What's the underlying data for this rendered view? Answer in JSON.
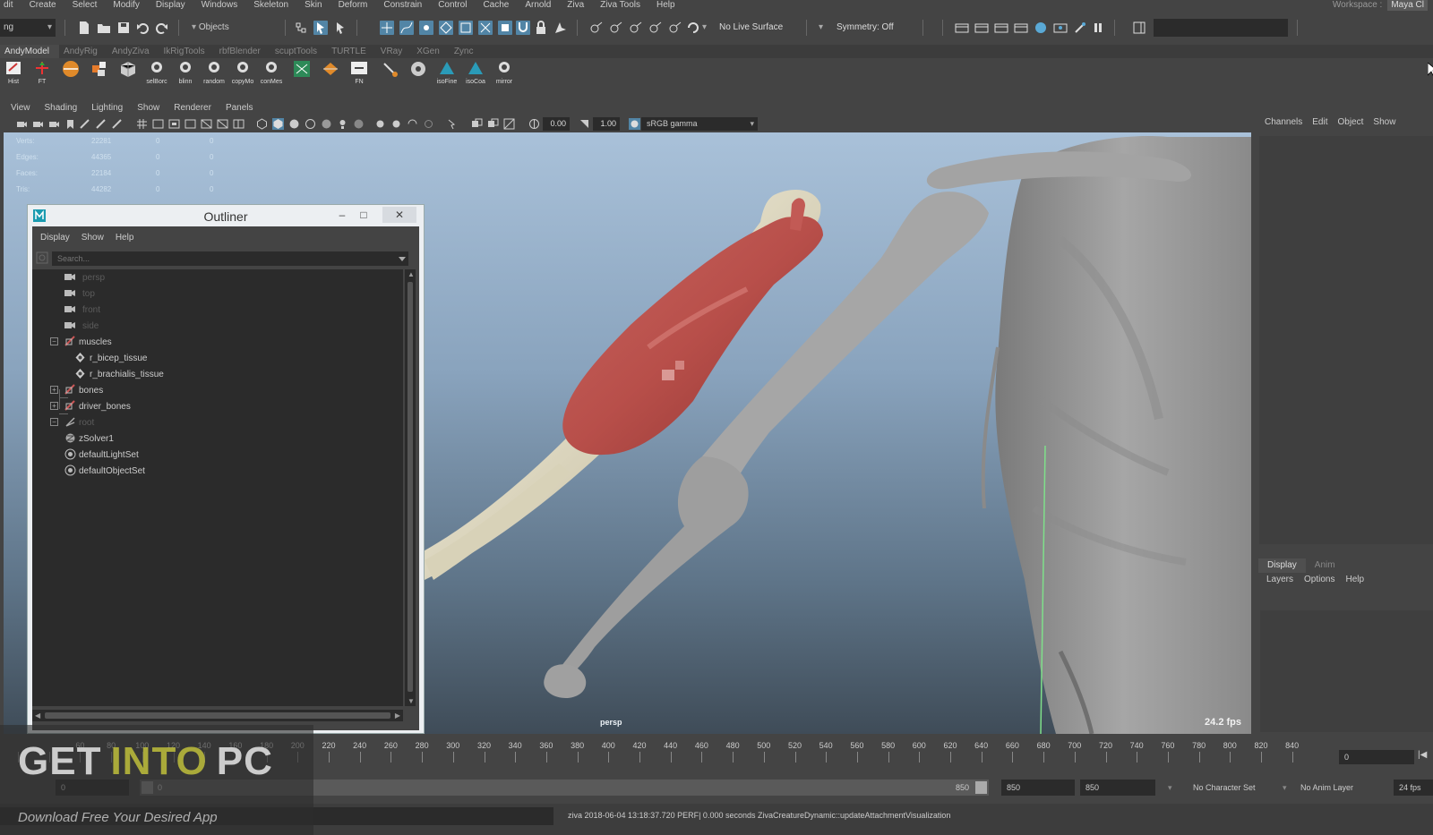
{
  "menubar": {
    "items": [
      "dit",
      "Create",
      "Select",
      "Modify",
      "Display",
      "Windows",
      "Skeleton",
      "Skin",
      "Deform",
      "Constrain",
      "Control",
      "Cache",
      "Arnold",
      "Ziva",
      "Ziva Tools",
      "Help"
    ],
    "workspace_label": "Workspace :",
    "workspace_value": "Maya Cl"
  },
  "statusline": {
    "menuset": "ng",
    "selection_mode": "Objects",
    "live_surface": "No Live Surface",
    "symmetry": "Symmetry: Off"
  },
  "shelf": {
    "tabs": [
      "AndyModel",
      "AndyRig",
      "AndyZiva",
      "IkRigTools",
      "rbfBlender",
      "scuptTools",
      "TURTLE",
      "VRay",
      "XGen",
      "Zync"
    ],
    "active_tab": "AndyModel",
    "buttons": [
      "Hist",
      "FT",
      "",
      "",
      "",
      "selBorc",
      "blinn",
      "random",
      "copyMo",
      "conMes",
      "",
      "",
      "FN",
      "",
      "",
      "isoFine",
      "isoCoa",
      "mirror"
    ]
  },
  "viewport": {
    "menu": [
      "View",
      "Shading",
      "Lighting",
      "Show",
      "Renderer",
      "Panels"
    ],
    "exposure": "0.00",
    "gamma": "1.00",
    "color_space": "sRGB gamma",
    "camera": "persp",
    "fps": "24.2 fps",
    "hud": [
      {
        "label": "Verts:",
        "value": "22281",
        "a": "0",
        "b": "0"
      },
      {
        "label": "Edges:",
        "value": "44365",
        "a": "0",
        "b": "0"
      },
      {
        "label": "Faces:",
        "value": "22184",
        "a": "0",
        "b": "0"
      },
      {
        "label": "Tris:",
        "value": "44282",
        "a": "0",
        "b": "0"
      }
    ],
    "colors": {
      "muscle": "#b8504c",
      "bone_ivory": "#e2dcc4",
      "bone_gray": "#a5a5a5"
    }
  },
  "outliner": {
    "title": "Outliner",
    "menu": [
      "Display",
      "Show",
      "Help"
    ],
    "search_placeholder": "Search...",
    "items": [
      {
        "label": "persp",
        "icon": "camera-icon",
        "dim": true
      },
      {
        "label": "top",
        "icon": "camera-icon",
        "dim": true
      },
      {
        "label": "front",
        "icon": "camera-icon",
        "dim": true
      },
      {
        "label": "side",
        "icon": "camera-icon",
        "dim": true
      },
      {
        "label": "muscles",
        "icon": "group-icon",
        "dim": false,
        "expander": "minus"
      },
      {
        "label": "r_bicep_tissue",
        "icon": "tissue-icon",
        "dim": false
      },
      {
        "label": "r_brachialis_tissue",
        "icon": "tissue-icon",
        "dim": false
      },
      {
        "label": "bones",
        "icon": "group-icon",
        "dim": false,
        "expander": "plus"
      },
      {
        "label": "driver_bones",
        "icon": "group-icon",
        "dim": false,
        "expander": "plus"
      },
      {
        "label": "root",
        "icon": "joint-icon",
        "dim": true,
        "expander": "minus"
      },
      {
        "label": "zSolver1",
        "icon": "solver-icon",
        "dim": false
      },
      {
        "label": "defaultLightSet",
        "icon": "set-icon",
        "dim": false
      },
      {
        "label": "defaultObjectSet",
        "icon": "set-icon",
        "dim": false
      }
    ]
  },
  "channelbox": {
    "menu": [
      "Channels",
      "Edit",
      "Object",
      "Show"
    ]
  },
  "layer_editor": {
    "tabs": [
      "Display",
      "Anim"
    ],
    "active_tab": "Display",
    "menu": [
      "Layers",
      "Options",
      "Help"
    ]
  },
  "timeslider": {
    "ticks": [
      "",
      "",
      "60",
      "80",
      "100",
      "120",
      "140",
      "160",
      "180",
      "200",
      "220",
      "240",
      "260",
      "280",
      "300",
      "320",
      "340",
      "360",
      "380",
      "400",
      "420",
      "440",
      "460",
      "480",
      "500",
      "520",
      "540",
      "560",
      "580",
      "600",
      "620",
      "640",
      "660",
      "680",
      "700",
      "720",
      "740",
      "760",
      "780",
      "800",
      "820",
      "840"
    ],
    "current_frame": "0"
  },
  "rangeslider": {
    "start_field": "0",
    "bar_start": "0",
    "bar_end": "850",
    "end_field": "850",
    "end_field2": "850",
    "character_set": "No Character Set",
    "anim_layer": "No Anim Layer",
    "fps": "24 fps"
  },
  "helpline": {
    "text": "ziva 2018-06-04 13:18:37.720 PERF|   0.000 seconds   ZivaCreatureDynamic::updateAttachmentVisualization"
  },
  "watermark": {
    "word1": "GET",
    "word2": "INTO",
    "word3": "PC",
    "subtitle": "Download Free Your Desired App"
  }
}
